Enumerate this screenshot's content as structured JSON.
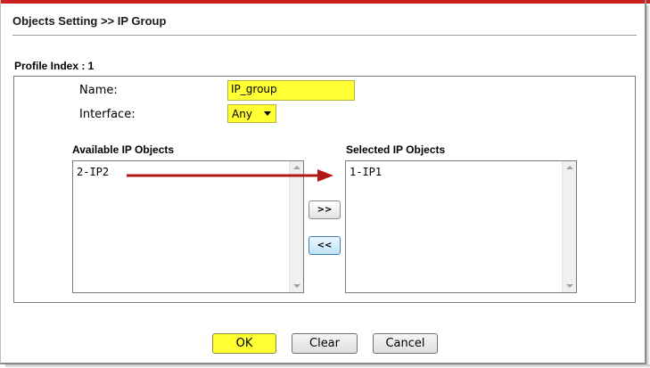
{
  "page": {
    "title": "Objects Setting >> IP Group"
  },
  "profile": {
    "index_label": "Profile Index : 1"
  },
  "form": {
    "name_label": "Name:",
    "name_value": "IP_group",
    "interface_label": "Interface:",
    "interface_value": "Any"
  },
  "available": {
    "heading": "Available IP Objects",
    "items": [
      "2-IP2"
    ]
  },
  "selected": {
    "heading": "Selected IP Objects",
    "items": [
      "1-IP1"
    ]
  },
  "buttons": {
    "add": ">>",
    "remove": "<<",
    "ok": "OK",
    "clear": "Clear",
    "cancel": "Cancel"
  },
  "colors": {
    "accent_bar": "#cc1f1f",
    "highlight_field": "#ffff33",
    "annotation_arrow": "#b01818"
  }
}
